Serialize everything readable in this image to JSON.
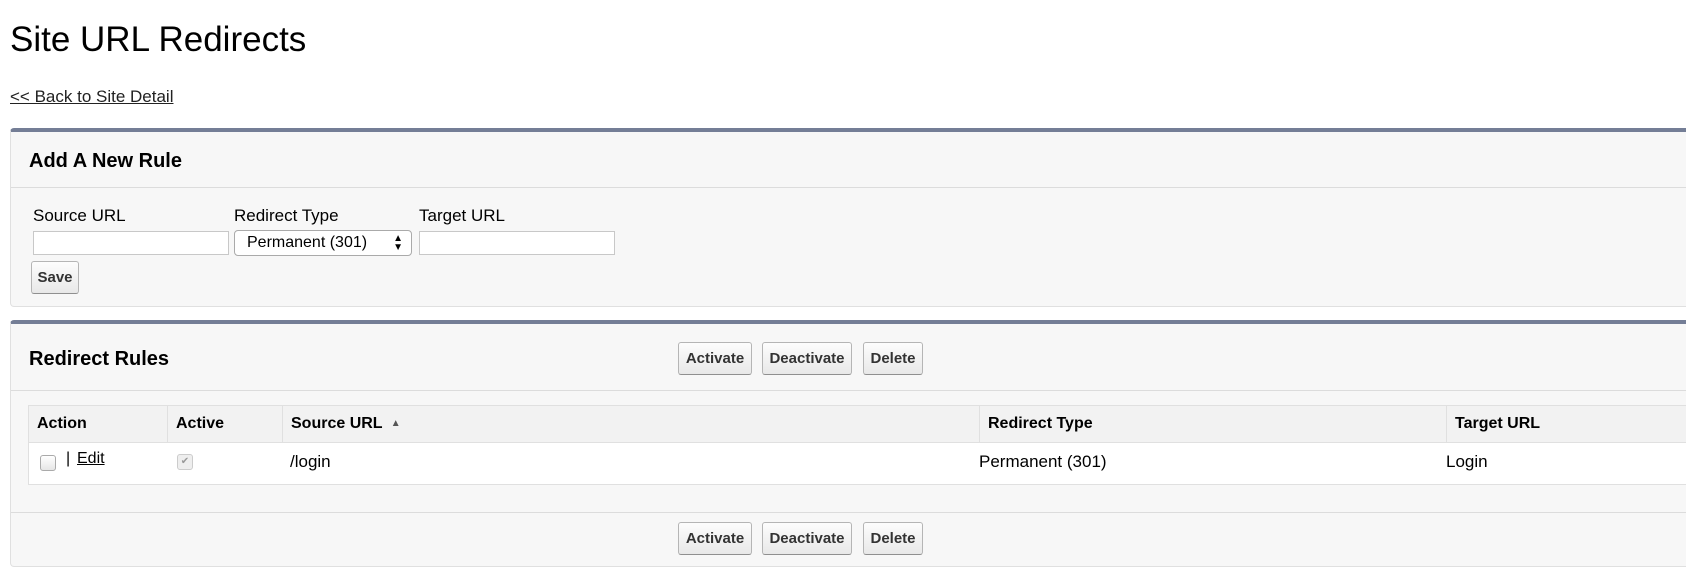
{
  "page": {
    "title": "Site URL Redirects",
    "back_link": "<< Back to Site Detail"
  },
  "add_rule": {
    "title": "Add A New Rule",
    "source_label": "Source URL",
    "source_value": "",
    "type_label": "Redirect Type",
    "type_value": "Permanent (301)",
    "target_label": "Target URL",
    "target_value": "",
    "save": "Save"
  },
  "rules": {
    "title": "Redirect Rules",
    "buttons": {
      "activate": "Activate",
      "deactivate": "Deactivate",
      "delete": "Delete"
    },
    "columns": [
      "Action",
      "Active",
      "Source URL",
      "Redirect Type",
      "Target URL"
    ],
    "sort_indicator": "▲",
    "rows": [
      {
        "separator": "|",
        "edit": "Edit",
        "active": true,
        "source": "/login",
        "type": "Permanent (301)",
        "target": "Login"
      }
    ]
  },
  "colors": {
    "panel_accent": "#747e96",
    "panel_bg": "#f7f7f7"
  }
}
